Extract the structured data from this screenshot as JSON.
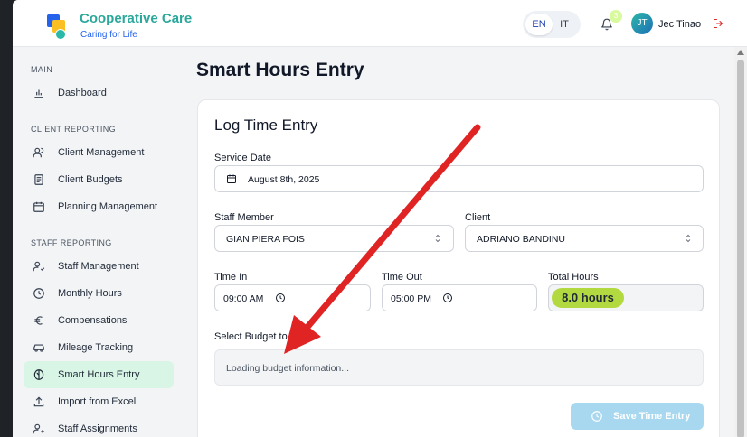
{
  "header": {
    "brand_name": "Cooperative Care",
    "brand_tagline": "Caring for Life",
    "lang_en": "EN",
    "lang_it": "IT",
    "notification_count": "3",
    "user_initials": "JT",
    "user_name": "Jec Tinao"
  },
  "sidebar": {
    "sections": [
      {
        "title": "MAIN"
      },
      {
        "title": "CLIENT REPORTING"
      },
      {
        "title": "STAFF REPORTING"
      }
    ],
    "items": [
      {
        "label": "Dashboard",
        "icon": "bar-chart-icon"
      },
      {
        "label": "Client Management",
        "icon": "users-icon"
      },
      {
        "label": "Client Budgets",
        "icon": "document-icon"
      },
      {
        "label": "Planning Management",
        "icon": "calendar-icon"
      },
      {
        "label": "Staff Management",
        "icon": "user-check-icon"
      },
      {
        "label": "Monthly Hours",
        "icon": "clock-icon"
      },
      {
        "label": "Compensations",
        "icon": "euro-icon"
      },
      {
        "label": "Mileage Tracking",
        "icon": "car-icon"
      },
      {
        "label": "Smart Hours Entry",
        "icon": "brain-icon",
        "active": true
      },
      {
        "label": "Import from Excel",
        "icon": "upload-icon"
      },
      {
        "label": "Staff Assignments",
        "icon": "user-plus-icon"
      }
    ]
  },
  "page": {
    "title": "Smart Hours Entry",
    "card_title": "Log Time Entry",
    "service_date_label": "Service Date",
    "service_date_value": "August 8th, 2025",
    "staff_label": "Staff Member",
    "staff_value": "GIAN PIERA FOIS",
    "client_label": "Client",
    "client_value": "ADRIANO BANDINU",
    "time_in_label": "Time In",
    "time_in_value": "09:00 AM",
    "time_out_label": "Time Out",
    "time_out_value": "05:00 PM",
    "total_label": "Total Hours",
    "total_value": "8.0 hours",
    "budget_label": "Select Budget to U",
    "budget_placeholder": "Loading budget information...",
    "save_label": "Save Time Entry"
  },
  "colors": {
    "accent_teal": "#2aa89b",
    "active_item_bg": "#d8f5e6",
    "total_pill": "#b3d940",
    "save_button": "#a7d8f0",
    "annotation_arrow": "#e02424"
  }
}
